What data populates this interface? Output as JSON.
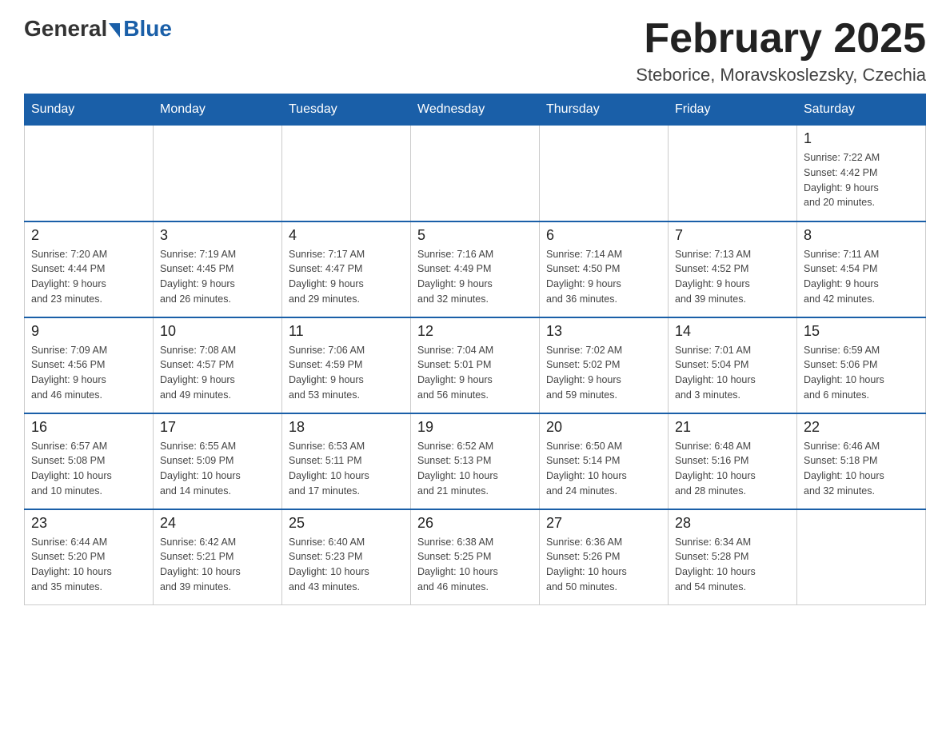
{
  "header": {
    "logo_general": "General",
    "logo_blue": "Blue",
    "month_title": "February 2025",
    "location": "Steborice, Moravskoslezsky, Czechia"
  },
  "weekdays": [
    "Sunday",
    "Monday",
    "Tuesday",
    "Wednesday",
    "Thursday",
    "Friday",
    "Saturday"
  ],
  "weeks": [
    {
      "days": [
        {
          "num": "",
          "info": ""
        },
        {
          "num": "",
          "info": ""
        },
        {
          "num": "",
          "info": ""
        },
        {
          "num": "",
          "info": ""
        },
        {
          "num": "",
          "info": ""
        },
        {
          "num": "",
          "info": ""
        },
        {
          "num": "1",
          "info": "Sunrise: 7:22 AM\nSunset: 4:42 PM\nDaylight: 9 hours\nand 20 minutes."
        }
      ]
    },
    {
      "days": [
        {
          "num": "2",
          "info": "Sunrise: 7:20 AM\nSunset: 4:44 PM\nDaylight: 9 hours\nand 23 minutes."
        },
        {
          "num": "3",
          "info": "Sunrise: 7:19 AM\nSunset: 4:45 PM\nDaylight: 9 hours\nand 26 minutes."
        },
        {
          "num": "4",
          "info": "Sunrise: 7:17 AM\nSunset: 4:47 PM\nDaylight: 9 hours\nand 29 minutes."
        },
        {
          "num": "5",
          "info": "Sunrise: 7:16 AM\nSunset: 4:49 PM\nDaylight: 9 hours\nand 32 minutes."
        },
        {
          "num": "6",
          "info": "Sunrise: 7:14 AM\nSunset: 4:50 PM\nDaylight: 9 hours\nand 36 minutes."
        },
        {
          "num": "7",
          "info": "Sunrise: 7:13 AM\nSunset: 4:52 PM\nDaylight: 9 hours\nand 39 minutes."
        },
        {
          "num": "8",
          "info": "Sunrise: 7:11 AM\nSunset: 4:54 PM\nDaylight: 9 hours\nand 42 minutes."
        }
      ]
    },
    {
      "days": [
        {
          "num": "9",
          "info": "Sunrise: 7:09 AM\nSunset: 4:56 PM\nDaylight: 9 hours\nand 46 minutes."
        },
        {
          "num": "10",
          "info": "Sunrise: 7:08 AM\nSunset: 4:57 PM\nDaylight: 9 hours\nand 49 minutes."
        },
        {
          "num": "11",
          "info": "Sunrise: 7:06 AM\nSunset: 4:59 PM\nDaylight: 9 hours\nand 53 minutes."
        },
        {
          "num": "12",
          "info": "Sunrise: 7:04 AM\nSunset: 5:01 PM\nDaylight: 9 hours\nand 56 minutes."
        },
        {
          "num": "13",
          "info": "Sunrise: 7:02 AM\nSunset: 5:02 PM\nDaylight: 9 hours\nand 59 minutes."
        },
        {
          "num": "14",
          "info": "Sunrise: 7:01 AM\nSunset: 5:04 PM\nDaylight: 10 hours\nand 3 minutes."
        },
        {
          "num": "15",
          "info": "Sunrise: 6:59 AM\nSunset: 5:06 PM\nDaylight: 10 hours\nand 6 minutes."
        }
      ]
    },
    {
      "days": [
        {
          "num": "16",
          "info": "Sunrise: 6:57 AM\nSunset: 5:08 PM\nDaylight: 10 hours\nand 10 minutes."
        },
        {
          "num": "17",
          "info": "Sunrise: 6:55 AM\nSunset: 5:09 PM\nDaylight: 10 hours\nand 14 minutes."
        },
        {
          "num": "18",
          "info": "Sunrise: 6:53 AM\nSunset: 5:11 PM\nDaylight: 10 hours\nand 17 minutes."
        },
        {
          "num": "19",
          "info": "Sunrise: 6:52 AM\nSunset: 5:13 PM\nDaylight: 10 hours\nand 21 minutes."
        },
        {
          "num": "20",
          "info": "Sunrise: 6:50 AM\nSunset: 5:14 PM\nDaylight: 10 hours\nand 24 minutes."
        },
        {
          "num": "21",
          "info": "Sunrise: 6:48 AM\nSunset: 5:16 PM\nDaylight: 10 hours\nand 28 minutes."
        },
        {
          "num": "22",
          "info": "Sunrise: 6:46 AM\nSunset: 5:18 PM\nDaylight: 10 hours\nand 32 minutes."
        }
      ]
    },
    {
      "days": [
        {
          "num": "23",
          "info": "Sunrise: 6:44 AM\nSunset: 5:20 PM\nDaylight: 10 hours\nand 35 minutes."
        },
        {
          "num": "24",
          "info": "Sunrise: 6:42 AM\nSunset: 5:21 PM\nDaylight: 10 hours\nand 39 minutes."
        },
        {
          "num": "25",
          "info": "Sunrise: 6:40 AM\nSunset: 5:23 PM\nDaylight: 10 hours\nand 43 minutes."
        },
        {
          "num": "26",
          "info": "Sunrise: 6:38 AM\nSunset: 5:25 PM\nDaylight: 10 hours\nand 46 minutes."
        },
        {
          "num": "27",
          "info": "Sunrise: 6:36 AM\nSunset: 5:26 PM\nDaylight: 10 hours\nand 50 minutes."
        },
        {
          "num": "28",
          "info": "Sunrise: 6:34 AM\nSunset: 5:28 PM\nDaylight: 10 hours\nand 54 minutes."
        },
        {
          "num": "",
          "info": ""
        }
      ]
    }
  ]
}
